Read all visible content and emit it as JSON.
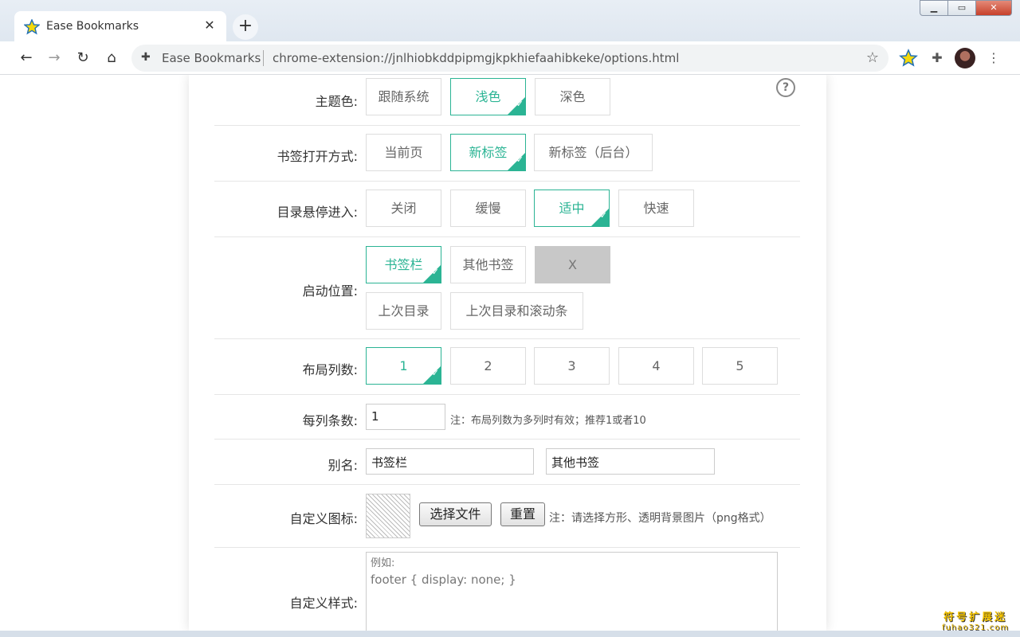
{
  "browser": {
    "tab_title": "Ease Bookmarks",
    "tab_close": "✕",
    "new_tab": "+",
    "window_buttons": [
      "▁",
      "▭",
      "✕"
    ],
    "omnibox_name": "Ease Bookmarks",
    "url": "chrome-extension://jnlhiobkddpipmgjkpkhiefaahibkeke/options.html"
  },
  "options": {
    "help": "?",
    "theme": {
      "label": "主题色:",
      "options": [
        "跟随系统",
        "浅色",
        "深色"
      ],
      "selected": 1
    },
    "open_mode": {
      "label": "书签打开方式:",
      "options": [
        "当前页",
        "新标签",
        "新标签（后台）"
      ],
      "selected": 1
    },
    "hover": {
      "label": "目录悬停进入:",
      "options": [
        "关闭",
        "缓慢",
        "适中",
        "快速"
      ],
      "selected": 2
    },
    "start": {
      "label": "启动位置:",
      "options": [
        "书签栏",
        "其他书签",
        "X",
        "上次目录",
        "上次目录和滚动条"
      ],
      "selected": 0
    },
    "columns": {
      "label": "布局列数:",
      "options": [
        "1",
        "2",
        "3",
        "4",
        "5"
      ],
      "selected": 0
    },
    "per_column": {
      "label": "每列条数:",
      "value": "1",
      "note": "注：布局列数为多列时有效；推荐1或者10"
    },
    "alias": {
      "label": "别名:",
      "bookmarks_bar": "书签栏",
      "other": "其他书签"
    },
    "custom_icon": {
      "label": "自定义图标:",
      "choose": "选择文件",
      "reset": "重置",
      "note": "注：请选择方形、透明背景图片（png格式）"
    },
    "custom_style": {
      "label": "自定义样式:",
      "placeholder_line1": "例如:",
      "placeholder_line2": "footer { display: none; }"
    }
  },
  "watermark": {
    "line1": "符号扩展迷",
    "line2": "fuhao321.com"
  },
  "colors": {
    "accent": "#2bb494"
  }
}
